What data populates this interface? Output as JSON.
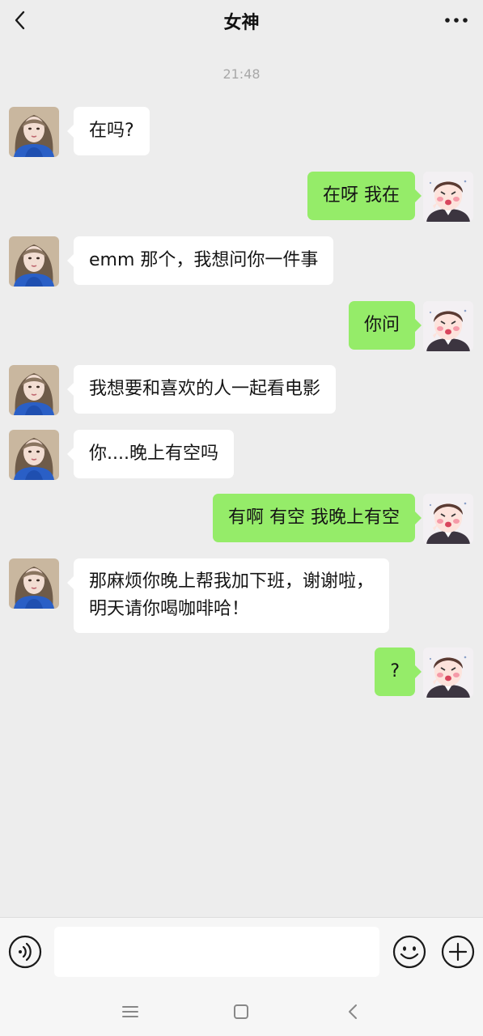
{
  "header": {
    "title": "女神",
    "back_icon": "chevron-left-icon",
    "more_icon": "more-icon"
  },
  "timestamp": "21:48",
  "messages": [
    {
      "from": "contact",
      "text": "在吗?"
    },
    {
      "from": "me",
      "text": "在呀  我在"
    },
    {
      "from": "contact",
      "text": "emm 那个，我想问你一件事"
    },
    {
      "from": "me",
      "text": "你问"
    },
    {
      "from": "contact",
      "text": "我想要和喜欢的人一起看电影"
    },
    {
      "from": "contact",
      "text": "你....晚上有空吗"
    },
    {
      "from": "me",
      "text": "有啊  有空   我晚上有空"
    },
    {
      "from": "contact",
      "lines": [
        "那麻烦你晚上帮我加下班，谢谢啦，",
        "明天请你喝咖啡哈！"
      ]
    },
    {
      "from": "me",
      "text": "?"
    }
  ],
  "input": {
    "value": "",
    "voice_icon": "voice-icon",
    "emoji_icon": "emoji-icon",
    "plus_icon": "plus-icon"
  },
  "navbar": {
    "menu_icon": "menu-icon",
    "home_icon": "home-icon",
    "back_icon": "back-icon"
  },
  "colors": {
    "background": "#ededed",
    "outgoing_bubble": "#95ec69",
    "incoming_bubble": "#ffffff"
  }
}
